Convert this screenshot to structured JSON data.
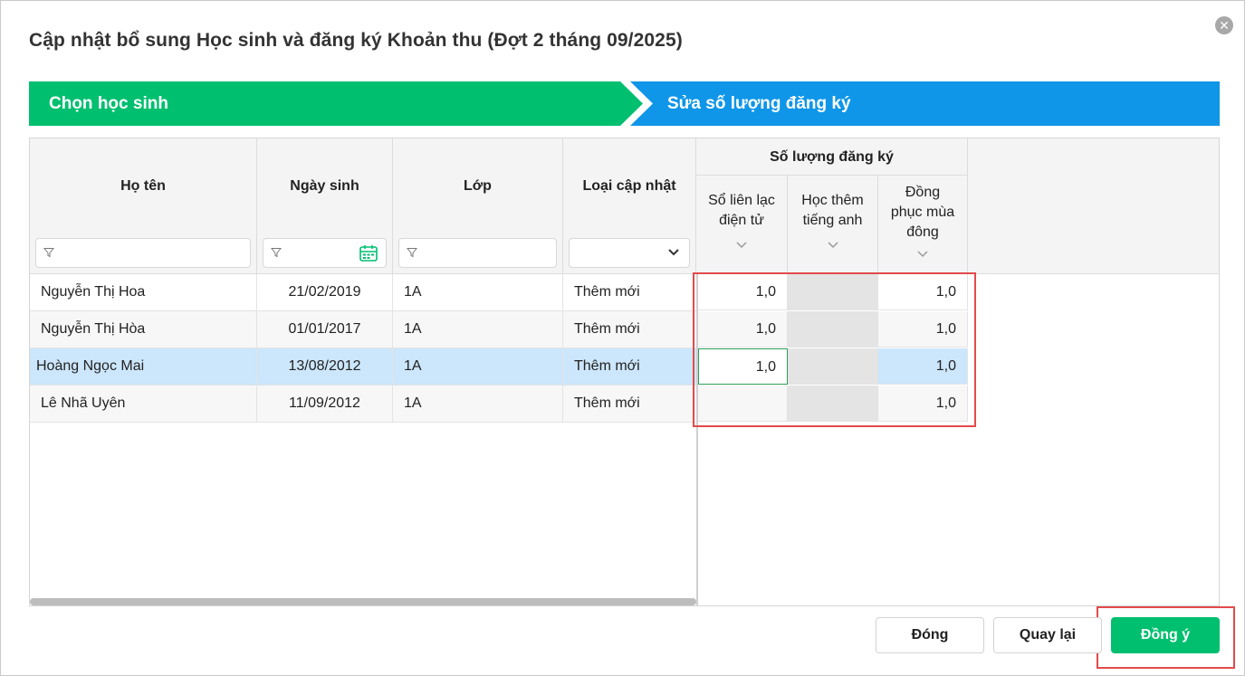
{
  "dialog": {
    "title": "Cập nhật bổ sung Học sinh và đăng ký Khoản thu (Đợt 2 tháng 09/2025)",
    "close_icon": "close-icon"
  },
  "steps": {
    "step1": "Chọn học sinh",
    "step2": "Sửa số lượng đăng ký"
  },
  "table": {
    "columns": {
      "name": "Họ tên",
      "dob": "Ngày sinh",
      "class": "Lớp",
      "update_type": "Loại cập nhật"
    },
    "group_header": "Số lượng đăng ký",
    "sub_columns": {
      "c1_line1": "Sổ liên lạc",
      "c1_line2": "điện tử",
      "c2_line1": "Học thêm",
      "c2_line2": "tiếng anh",
      "c3_line1": "Đồng",
      "c3_line2": "phục mùa",
      "c3_line3": "đông"
    },
    "rows": [
      {
        "name": "Nguyễn Thị Hoa",
        "dob": "21/02/2019",
        "class": "1A",
        "update_type": "Thêm mới",
        "c1": "1,0",
        "c2": "",
        "c3": "1,0"
      },
      {
        "name": "Nguyễn Thị Hòa",
        "dob": "01/01/2017",
        "class": "1A",
        "update_type": "Thêm mới",
        "c1": "1,0",
        "c2": "",
        "c3": "1,0"
      },
      {
        "name": "Hoàng Ngọc Mai",
        "dob": "13/08/2012",
        "class": "1A",
        "update_type": "Thêm mới",
        "c1": "1,0",
        "c2": "",
        "c3": "1,0"
      },
      {
        "name": "Lê Nhã Uyên",
        "dob": "11/09/2012",
        "class": "1A",
        "update_type": "Thêm mới",
        "c1": "",
        "c2": "",
        "c3": "1,0"
      }
    ]
  },
  "buttons": {
    "close": "Đóng",
    "back": "Quay lại",
    "ok": "Đồng ý"
  },
  "colors": {
    "step_active": "#00bf6f",
    "step_current": "#0f96e8",
    "selected_row": "#cce6fb",
    "highlight": "#e24b4b"
  }
}
